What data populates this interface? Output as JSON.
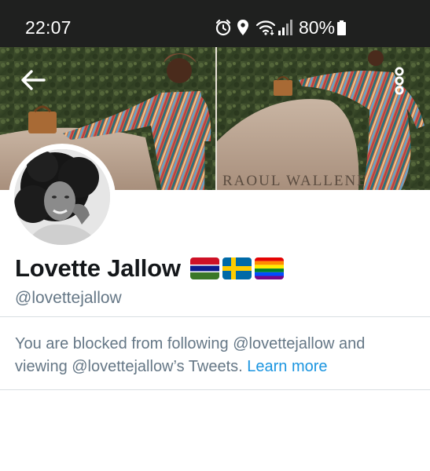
{
  "status_bar": {
    "time": "22:07",
    "battery_percent": "80%",
    "icons": [
      "alarm-icon",
      "location-icon",
      "wifi-icon",
      "signal-icon",
      "battery-icon"
    ]
  },
  "header": {
    "back_icon": "arrow-left-icon",
    "more_icon": "more-vertical-icon"
  },
  "banner": {
    "plaque_text": "RAOUL WALLENE"
  },
  "profile": {
    "name": "Lovette Jallow",
    "flags": [
      "gambia-flag-icon",
      "sweden-flag-icon",
      "rainbow-flag-icon"
    ],
    "handle": "@lovettejallow"
  },
  "blocked_notice": {
    "message": "You are blocked from following @lovettejallow and viewing @lovettejallow’s Tweets.",
    "link_label": "Learn more"
  },
  "colors": {
    "status_bar_bg": "#1f201f",
    "name_text": "#14171a",
    "secondary_text": "#657786",
    "link": "#1b95e0",
    "divider": "#d9dee2"
  }
}
